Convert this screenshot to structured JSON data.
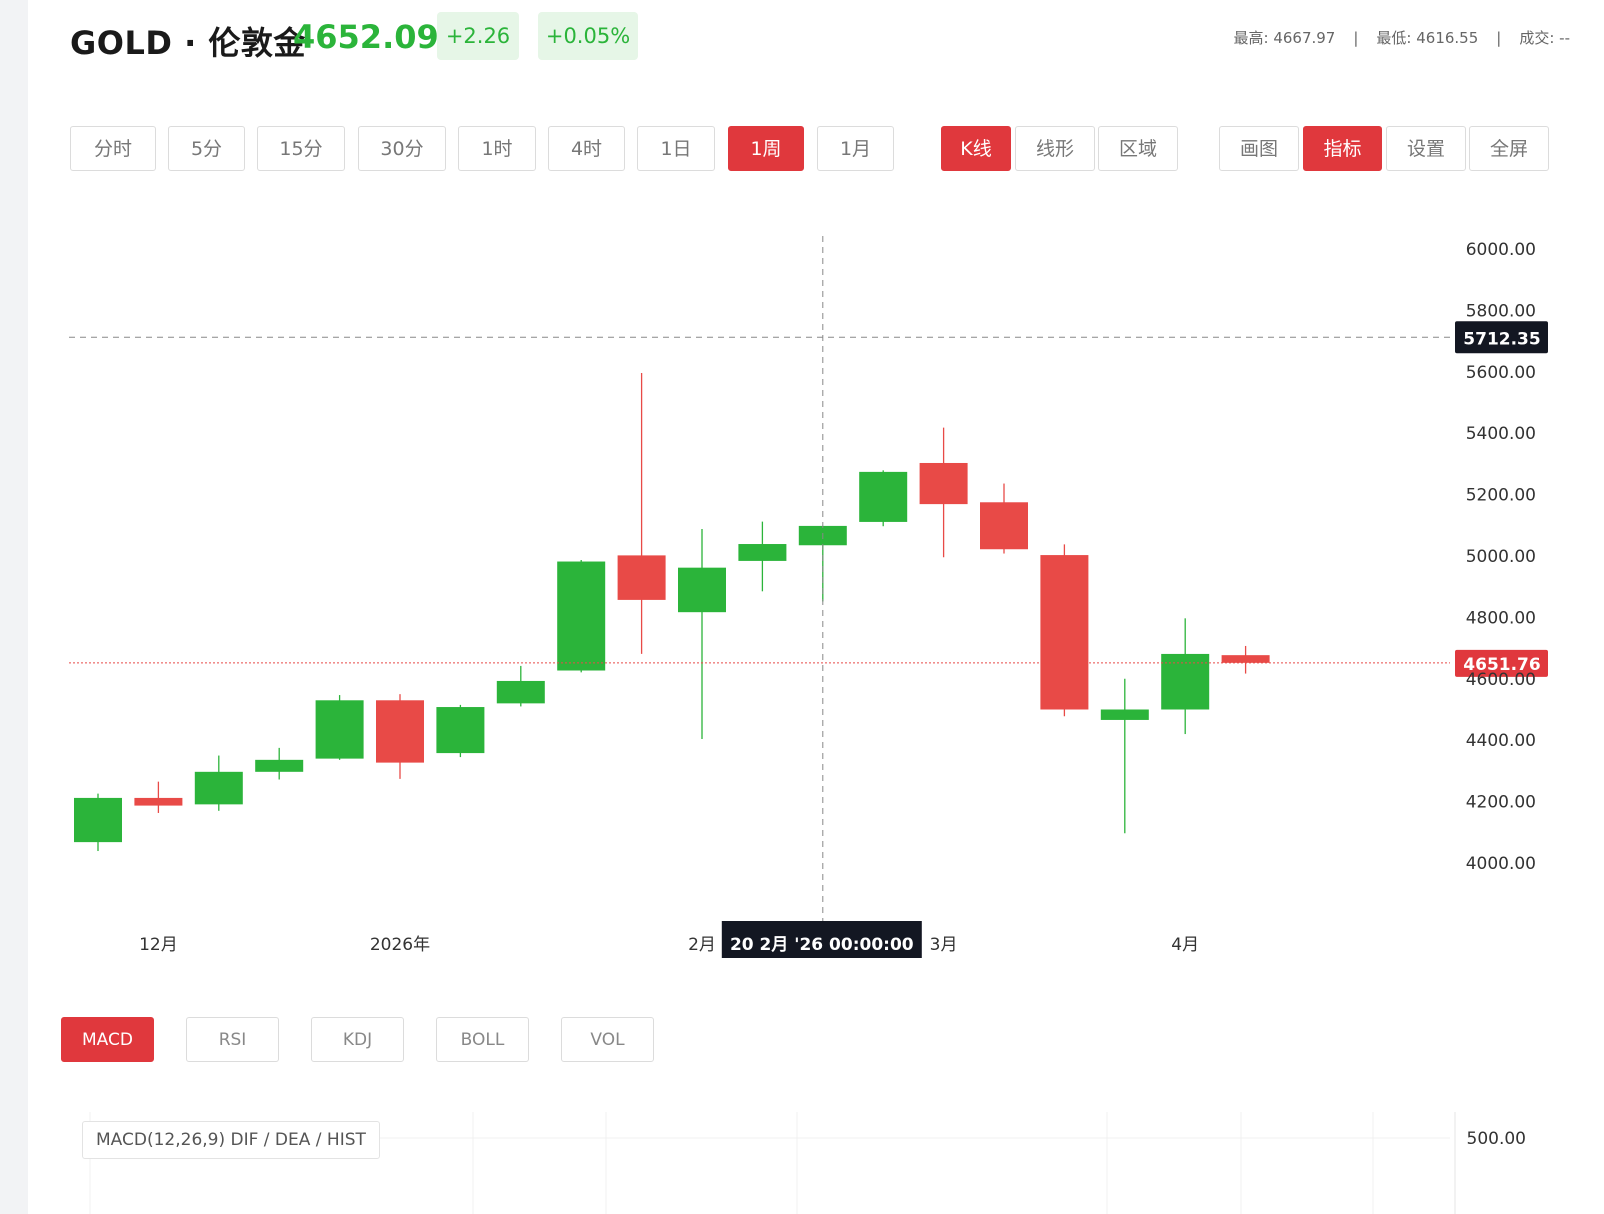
{
  "header": {
    "symbol": "GOLD · 伦敦金",
    "price": "4652.09",
    "change": "+2.26",
    "change_pct": "+0.05%",
    "high_label": "最高: 4667.97",
    "low_label": "最低: 4616.55",
    "volume_label": "成交: --",
    "separator": "|"
  },
  "periods": [
    {
      "label": "分时",
      "active": false
    },
    {
      "label": "5分",
      "active": false
    },
    {
      "label": "15分",
      "active": false
    },
    {
      "label": "30分",
      "active": false
    },
    {
      "label": "1时",
      "active": false
    },
    {
      "label": "4时",
      "active": false
    },
    {
      "label": "1日",
      "active": false
    },
    {
      "label": "1周",
      "active": true
    },
    {
      "label": "1月",
      "active": false
    }
  ],
  "chart_types": [
    {
      "label": "K线",
      "active": true
    },
    {
      "label": "线形",
      "active": false
    },
    {
      "label": "区域",
      "active": false
    }
  ],
  "tools": [
    {
      "label": "画图",
      "active": false
    },
    {
      "label": "指标",
      "active": true
    },
    {
      "label": "设置",
      "active": false
    },
    {
      "label": "全屏",
      "active": false
    }
  ],
  "indicators": [
    {
      "label": "MACD",
      "active": true
    },
    {
      "label": "RSI",
      "active": false
    },
    {
      "label": "KDJ",
      "active": false
    },
    {
      "label": "BOLL",
      "active": false
    },
    {
      "label": "VOL",
      "active": false
    }
  ],
  "macd": {
    "label": "MACD(12,26,9) DIF / DEA / HIST",
    "axis_value": "500.00"
  },
  "colors": {
    "up": "#2bb43a",
    "down": "#e84a47",
    "accent": "#e0383d",
    "crosshair_label_bg": "#131722"
  },
  "crosshair": {
    "price_label": "5712.35",
    "time_label": "20 2月 '26   00:00:00",
    "price_value": 5712.35
  },
  "last_price": {
    "label": "4651.76",
    "value": 4651.76
  },
  "chart_data": {
    "type": "candlestick",
    "ylim": [
      3850,
      6050
    ],
    "y_ticks": [
      "4000.00",
      "4200.00",
      "4400.00",
      "4600.00",
      "4800.00",
      "5000.00",
      "5200.00",
      "5400.00",
      "5600.00",
      "5800.00",
      "6000.00"
    ],
    "x_ticks": [
      {
        "label": "12月",
        "index": 1
      },
      {
        "label": "2026年",
        "index": 5
      },
      {
        "label": "2月",
        "index": 10
      },
      {
        "label": "3月",
        "index": 14
      },
      {
        "label": "4月",
        "index": 18
      }
    ],
    "crosshair_index": 12,
    "candles": [
      {
        "open": 4068,
        "close": 4212,
        "high": 4226,
        "low": 4039
      },
      {
        "open": 4212,
        "close": 4187,
        "high": 4265,
        "low": 4163
      },
      {
        "open": 4191,
        "close": 4297,
        "high": 4350,
        "low": 4170
      },
      {
        "open": 4297,
        "close": 4336,
        "high": 4375,
        "low": 4272
      },
      {
        "open": 4340,
        "close": 4530,
        "high": 4547,
        "low": 4336
      },
      {
        "open": 4530,
        "close": 4327,
        "high": 4550,
        "low": 4274
      },
      {
        "open": 4358,
        "close": 4508,
        "high": 4515,
        "low": 4345
      },
      {
        "open": 4520,
        "close": 4593,
        "high": 4642,
        "low": 4510
      },
      {
        "open": 4627,
        "close": 4982,
        "high": 4987,
        "low": 4621
      },
      {
        "open": 5002,
        "close": 4857,
        "high": 5596,
        "low": 4681
      },
      {
        "open": 4817,
        "close": 4962,
        "high": 5088,
        "low": 4404
      },
      {
        "open": 4984,
        "close": 5039,
        "high": 5112,
        "low": 4885
      },
      {
        "open": 5035,
        "close": 5098,
        "high": 5098,
        "low": 4852
      },
      {
        "open": 5111,
        "close": 5274,
        "high": 5279,
        "low": 5097
      },
      {
        "open": 5303,
        "close": 5169,
        "high": 5418,
        "low": 4996
      },
      {
        "open": 5175,
        "close": 5022,
        "high": 5236,
        "low": 5008
      },
      {
        "open": 5003,
        "close": 4500,
        "high": 5038,
        "low": 4478
      },
      {
        "open": 4466,
        "close": 4500,
        "high": 4600,
        "low": 4097
      },
      {
        "open": 4500,
        "close": 4681,
        "high": 4797,
        "low": 4420
      },
      {
        "open": 4677,
        "close": 4652,
        "high": 4707,
        "low": 4617
      }
    ]
  }
}
